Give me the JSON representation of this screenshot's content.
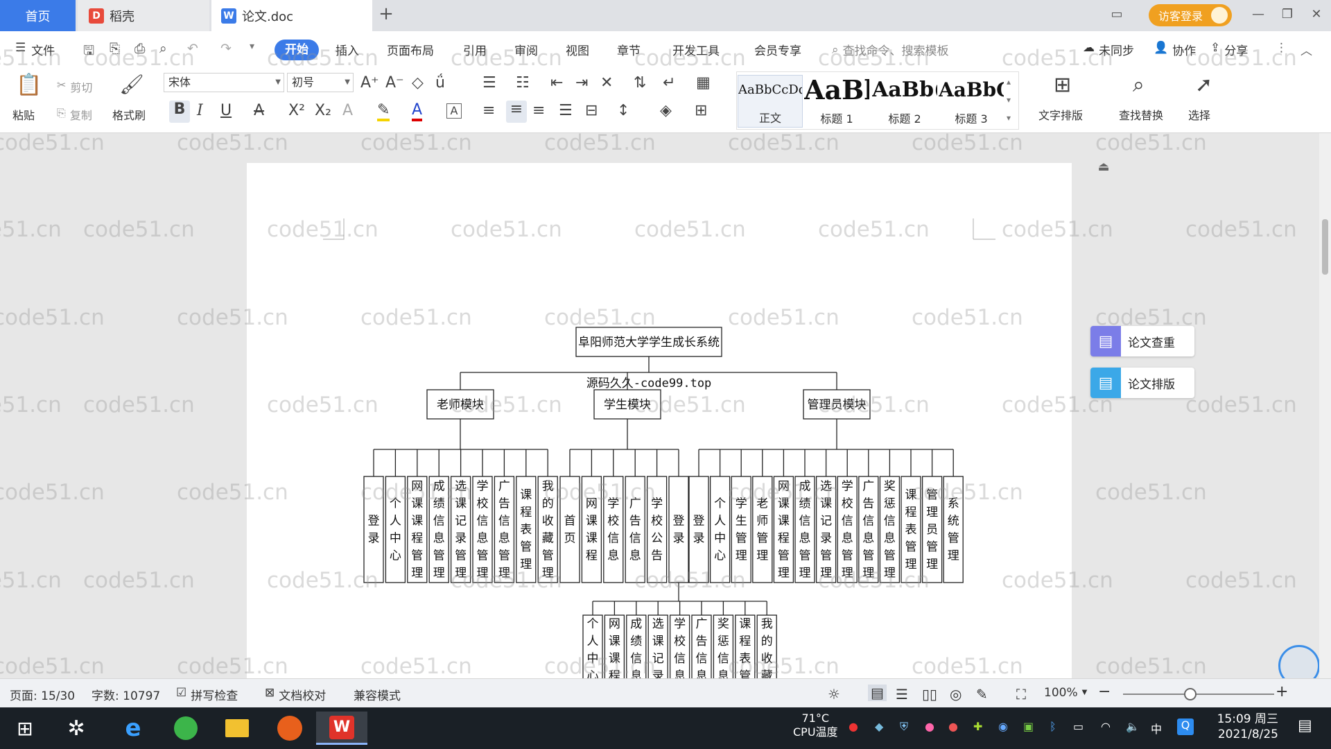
{
  "tabs": {
    "home": "首页",
    "daoke": "稻壳",
    "doc": "论文.doc"
  },
  "titlebar": {
    "login": "访客登录"
  },
  "menu": {
    "file": "文件",
    "items": [
      "开始",
      "插入",
      "页面布局",
      "引用",
      "审阅",
      "视图",
      "章节",
      "开发工具",
      "会员专享"
    ],
    "search_placeholder": "查找命令、搜索模板",
    "sync": "未同步",
    "collab": "协作",
    "share": "分享"
  },
  "ribbon": {
    "paste": "粘贴",
    "cut": "剪切",
    "copy": "复制",
    "format_painter": "格式刷",
    "font": "宋体",
    "size": "初号",
    "styles": [
      {
        "preview": "AaBbCcDd",
        "label": "正文"
      },
      {
        "preview": "AaBl",
        "label": "标题 1"
      },
      {
        "preview": "AaBb(",
        "label": "标题 2"
      },
      {
        "preview": "AaBbC",
        "label": "标题 3"
      }
    ],
    "text_layout": "文字排版",
    "find_replace": "查找替换",
    "select": "选择"
  },
  "side_panel": {
    "check": "论文查重",
    "layout": "论文排版"
  },
  "diagram": {
    "root": "阜阳师范大学学生成长系统",
    "overlay_text": "源码久久-code99.top",
    "modules": [
      "老师模块",
      "学生模块",
      "管理员模块"
    ],
    "teacher_items": [
      "登录",
      "个人中心",
      "网课课程管理",
      "成绩信息管理",
      "选课记录管理",
      "学校信息管理",
      "广告信息管理",
      "课程表管理",
      "我的收藏管理"
    ],
    "student_items": [
      "首页",
      "网课课程",
      "学校信息",
      "广告信息",
      "学校公告",
      "登录"
    ],
    "admin_items": [
      "登录",
      "个人中心",
      "学生管理",
      "老师管理",
      "网课课程管理",
      "成绩信息管理",
      "选课记录管理",
      "学校信息管理",
      "广告信息管理",
      "奖惩信息管理",
      "课程表管理",
      "管理员管理",
      "系统管理"
    ],
    "sub_items": [
      "个人中心",
      "网课课程管理",
      "成绩信息管理",
      "选课记录管理",
      "学校信息管理",
      "广告信息管理",
      "奖惩信息管理",
      "课程表管理",
      "我的收藏管理"
    ]
  },
  "watermark": "code51.cn",
  "status": {
    "page": "页面: 15/30",
    "words": "字数: 10797",
    "spell": "拼写检查",
    "proof": "文档校对",
    "compat": "兼容模式",
    "zoom": "100%"
  },
  "taskbar": {
    "cpu_temp": "71°C",
    "cpu_label": "CPU温度",
    "ime": "中",
    "time": "15:09 周三",
    "date": "2021/8/25"
  },
  "colors": {
    "accent": "#3b7be8",
    "login": "#f0a020"
  }
}
